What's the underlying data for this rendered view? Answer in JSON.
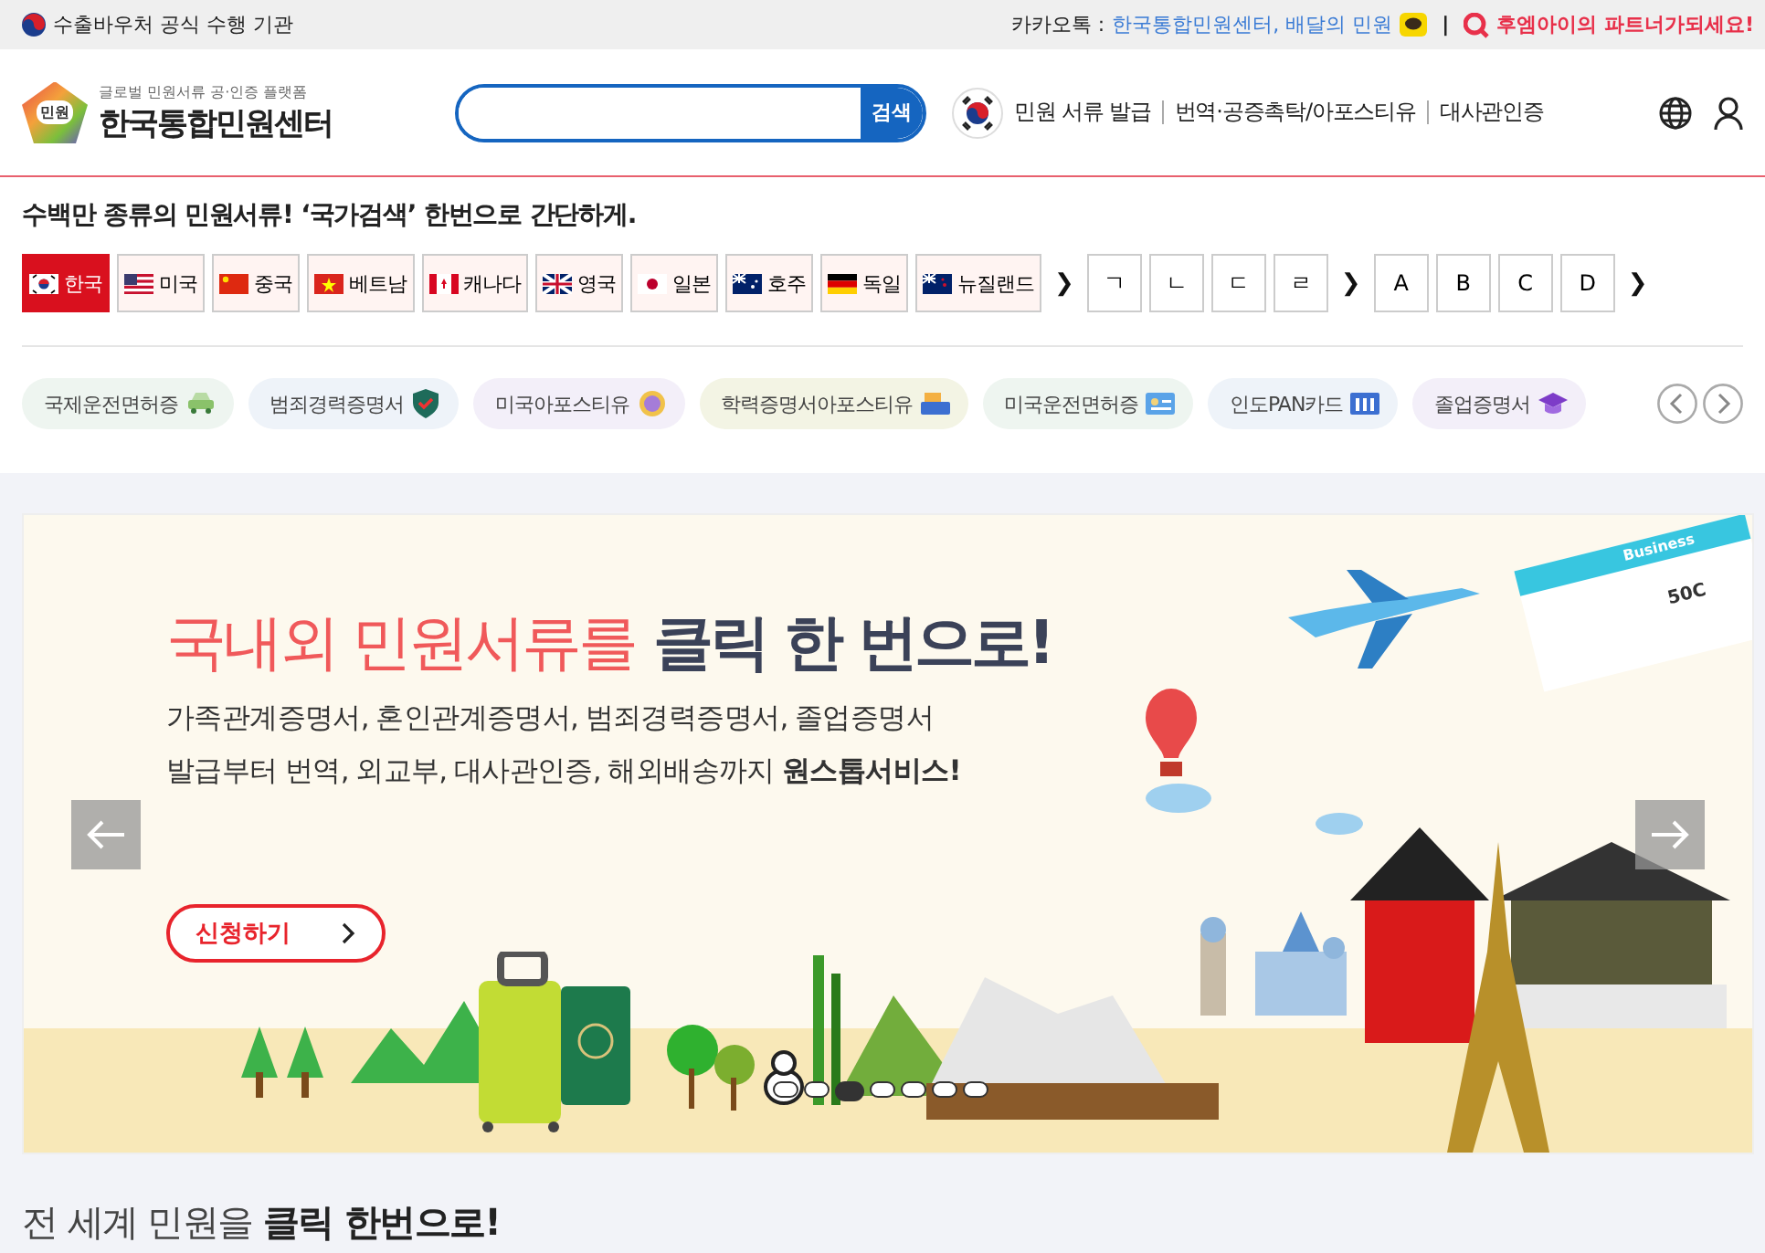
{
  "top_bar": {
    "left_text": "수출바우처 공식 수행 기관",
    "kakao_label": "카카오톡 :",
    "kakao_link": "한국통합민원센터, 배달의 민원",
    "separator": "|",
    "partner_link": "후엠아이의 파트너가되세요!"
  },
  "header": {
    "tagline": "글로벌 민원서류 공·인증 플랫폼",
    "logo_badge": "민원",
    "logo_text": "한국통합민원센터",
    "search": {
      "button": "검색"
    },
    "nav": [
      "민원 서류 발급",
      "번역·공증촉탁/아포스티유",
      "대사관인증"
    ]
  },
  "country_search": {
    "headline": "수백만 종류의 민원서류! ‘국가검색’ 한번으로 간단하게.",
    "countries": [
      {
        "label": "한국",
        "selected": true
      },
      {
        "label": "미국",
        "selected": false
      },
      {
        "label": "중국",
        "selected": false
      },
      {
        "label": "베트남",
        "selected": false
      },
      {
        "label": "캐나다",
        "selected": false
      },
      {
        "label": "영국",
        "selected": false
      },
      {
        "label": "일본",
        "selected": false
      },
      {
        "label": "호주",
        "selected": false
      },
      {
        "label": "독일",
        "selected": false
      },
      {
        "label": "뉴질랜드",
        "selected": false
      }
    ],
    "more": "❯",
    "consonants": [
      "ㄱ",
      "ㄴ",
      "ㄷ",
      "ㄹ"
    ],
    "letters": [
      "A",
      "B",
      "C",
      "D"
    ]
  },
  "categories": [
    {
      "label": "국제운전면허증",
      "color": "#eef5f0"
    },
    {
      "label": "범죄경력증명서",
      "color": "#eef3f9"
    },
    {
      "label": "미국아포스티유",
      "color": "#f3eff9"
    },
    {
      "label": "학력증명서아포스티유",
      "color": "#f3f4e4"
    },
    {
      "label": "미국운전면허증",
      "color": "#eef5f0"
    },
    {
      "label": "인도PAN카드",
      "color": "#eef3f9"
    },
    {
      "label": "졸업증명서",
      "color": "#f3eff9"
    }
  ],
  "banner": {
    "headline_red": "국내외 민원서류를",
    "headline_dark": "클릭 한 번으로!",
    "lines": [
      "가족관계증명서, 혼인관계증명서, 범죄경력증명서, 졸업증명서",
      "발급부터 번역, 외교부, 대사관인증, 해외배송까지 **원스톱서비스!**"
    ],
    "button": "신청하기",
    "ticket_class": "Business",
    "ticket_seat": "50C",
    "dots": [
      {
        "selected": false
      },
      {
        "selected": false
      },
      {
        "selected": true
      },
      {
        "selected": false
      },
      {
        "selected": false
      },
      {
        "selected": false
      },
      {
        "selected": false
      }
    ]
  },
  "section_title": "전 세계 민원을 **클릭 한번으로!**"
}
